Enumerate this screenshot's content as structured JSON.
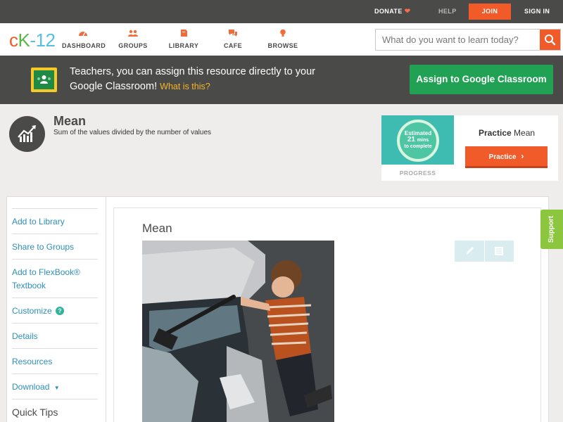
{
  "topbar": {
    "donate": "DONATE",
    "help": "HELP",
    "join": "JOIN",
    "signin": "SIGN IN"
  },
  "brand": {
    "logo_c": "c",
    "logo_k": "K",
    "logo_num": "-12"
  },
  "nav": {
    "items": [
      {
        "label": "DASHBOARD",
        "icon": "dashboard-icon"
      },
      {
        "label": "GROUPS",
        "icon": "groups-icon"
      },
      {
        "label": "LIBRARY",
        "icon": "library-icon"
      },
      {
        "label": "CAFE",
        "icon": "cafe-icon"
      },
      {
        "label": "BROWSE",
        "icon": "browse-icon"
      }
    ],
    "search_placeholder": "What do you want to learn today?"
  },
  "classroom_banner": {
    "text": "Teachers, you can assign this resource directly to your Google Classroom!",
    "what_link": "What is this?",
    "button": "Assign to Google Classroom"
  },
  "concept": {
    "title": "Mean",
    "description": "Sum of the values divided by the number of values"
  },
  "practice": {
    "estimated_label": "Estimated",
    "minutes": "21",
    "mins_label": "mins",
    "to_complete": "to complete",
    "progress_label": "PROGRESS",
    "title_bold": "Practice",
    "title_rest": "Mean",
    "button": "Practice"
  },
  "sidebar": {
    "items": [
      {
        "label": "Add to Library"
      },
      {
        "label": "Share to Groups"
      },
      {
        "label": "Add to FlexBook® Textbook"
      },
      {
        "label": "Customize"
      },
      {
        "label": "Details"
      },
      {
        "label": "Resources"
      },
      {
        "label": "Download"
      }
    ],
    "quick_tips": "Quick Tips",
    "help_glyph": "?",
    "dropdown_glyph": "▼"
  },
  "main": {
    "title": "Mean"
  },
  "support": "Support",
  "colors": {
    "accent": "#f15a29",
    "link": "#2e8fb9",
    "banner": "#4a4a48",
    "classroom_button": "#20a153"
  }
}
